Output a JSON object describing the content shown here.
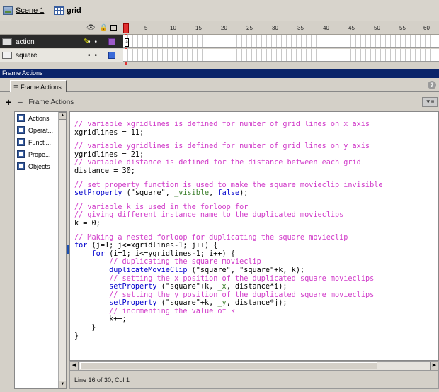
{
  "breadcrumb": {
    "scene": "Scene 1",
    "symbol": "grid"
  },
  "timeline": {
    "frame_numbers": [
      "1",
      "5",
      "10",
      "15",
      "20",
      "25",
      "30",
      "35",
      "40",
      "45",
      "50",
      "55",
      "60"
    ],
    "layers": [
      {
        "name": "action",
        "selected": true,
        "outline_color": "#9c5ac8"
      },
      {
        "name": "square",
        "selected": false,
        "outline_color": "#3a6ad8"
      }
    ],
    "keyframe_label": "a"
  },
  "panel": {
    "title": "Frame Actions",
    "tab_label": "Frame Actions",
    "actions_label": "Frame Actions",
    "help": "?"
  },
  "toolbox": {
    "items": [
      "Actions",
      "Operat...",
      "Functi...",
      "Prope...",
      "Objects"
    ]
  },
  "code": {
    "lines": [
      [
        {
          "t": "cm",
          "v": "// variable xgridlines is defined for number of grid lines on x axis"
        }
      ],
      [
        {
          "t": "pl",
          "v": "xgridlines = 11;"
        }
      ],
      "gap",
      [
        {
          "t": "cm",
          "v": "// variable ygridlines is defined for number of grid lines on y axis"
        }
      ],
      [
        {
          "t": "pl",
          "v": "ygridlines = 21;"
        }
      ],
      [
        {
          "t": "cm",
          "v": "// variable distance is defined for the distance between each grid"
        }
      ],
      [
        {
          "t": "pl",
          "v": "distance = 30;"
        }
      ],
      "gap",
      [
        {
          "t": "cm",
          "v": "// set property function is used to make the square movieclip invisible"
        }
      ],
      [
        {
          "t": "kw",
          "v": "setProperty"
        },
        {
          "t": "pl",
          "v": " (\"square\", "
        },
        {
          "t": "pp",
          "v": "_visible"
        },
        {
          "t": "pl",
          "v": ", "
        },
        {
          "t": "kw",
          "v": "false"
        },
        {
          "t": "pl",
          "v": ");"
        }
      ],
      "gap",
      [
        {
          "t": "cm",
          "v": "// variable k is used in the forloop for"
        }
      ],
      [
        {
          "t": "cm",
          "v": "// giving different instance name to the duplicated movieclips"
        }
      ],
      [
        {
          "t": "pl",
          "v": "k = 0;"
        }
      ],
      "gap",
      [
        {
          "t": "cm",
          "v": "// Making a nested forloop for duplicating the square movieclip"
        }
      ],
      [
        {
          "t": "kw",
          "v": "for"
        },
        {
          "t": "pl",
          "v": " (j=1; j<=xgridlines-1; j++) {"
        }
      ],
      [
        {
          "t": "pl",
          "v": "    "
        },
        {
          "t": "kw",
          "v": "for"
        },
        {
          "t": "pl",
          "v": " (i=1; i<=ygridlines-1; i++) {"
        }
      ],
      [
        {
          "t": "pl",
          "v": "        "
        },
        {
          "t": "cm",
          "v": "// duplicating the square movieclip"
        }
      ],
      [
        {
          "t": "pl",
          "v": "        "
        },
        {
          "t": "kw",
          "v": "duplicateMovieClip"
        },
        {
          "t": "pl",
          "v": " (\"square\", \"square\"+k, k);"
        }
      ],
      [
        {
          "t": "pl",
          "v": "        "
        },
        {
          "t": "cm",
          "v": "// setting the x position of the duplicated square movieclips"
        }
      ],
      [
        {
          "t": "pl",
          "v": "        "
        },
        {
          "t": "kw",
          "v": "setProperty"
        },
        {
          "t": "pl",
          "v": " (\"square\"+k, "
        },
        {
          "t": "pp",
          "v": "_x"
        },
        {
          "t": "pl",
          "v": ", distance*i);"
        }
      ],
      [
        {
          "t": "pl",
          "v": "        "
        },
        {
          "t": "cm",
          "v": "// setting the y position of the duplicated square movieclips"
        }
      ],
      [
        {
          "t": "pl",
          "v": "        "
        },
        {
          "t": "kw",
          "v": "setProperty"
        },
        {
          "t": "pl",
          "v": " (\"square\"+k, "
        },
        {
          "t": "pp",
          "v": "_y"
        },
        {
          "t": "pl",
          "v": ", distance*j);"
        }
      ],
      [
        {
          "t": "pl",
          "v": "        "
        },
        {
          "t": "cm",
          "v": "// incrmenting the value of k"
        }
      ],
      [
        {
          "t": "pl",
          "v": "        k++;"
        }
      ],
      [
        {
          "t": "pl",
          "v": "    }"
        }
      ],
      [
        {
          "t": "pl",
          "v": "}"
        }
      ]
    ]
  },
  "status": {
    "text": "Line 16 of 30, Col 1"
  }
}
